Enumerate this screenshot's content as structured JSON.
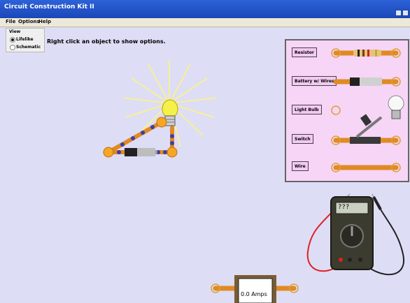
{
  "window": {
    "title": "Circuit Construction Kit II"
  },
  "menu": {
    "items": [
      "File",
      "Options",
      "Help"
    ]
  },
  "view_panel": {
    "title": "View",
    "options": [
      "Lifelike",
      "Schematic"
    ],
    "selected": "Lifelike"
  },
  "hint": "Right click an object to show options.",
  "toolbox": {
    "buttons": [
      "Resistor",
      "Battery w/ Wires",
      "Light Bulb",
      "Switch",
      "Wire"
    ]
  },
  "ammeter": {
    "reading": "0.0 Amps"
  },
  "voltmeter": {
    "display": "???"
  },
  "colors": {
    "title_bar": "#2d62d8",
    "canvas_bg": "#ddddf6",
    "toolbox_bg": "#f6d5f6",
    "wire": "#e08a22",
    "wire_joint": "#f5a623",
    "bulb": "#f6f04a",
    "probe_red": "#e02020",
    "probe_black": "#222222"
  },
  "icons": [
    "bulb-rays-icon",
    "battery-icon",
    "resistor-icon",
    "switch-icon",
    "multimeter-icon"
  ]
}
